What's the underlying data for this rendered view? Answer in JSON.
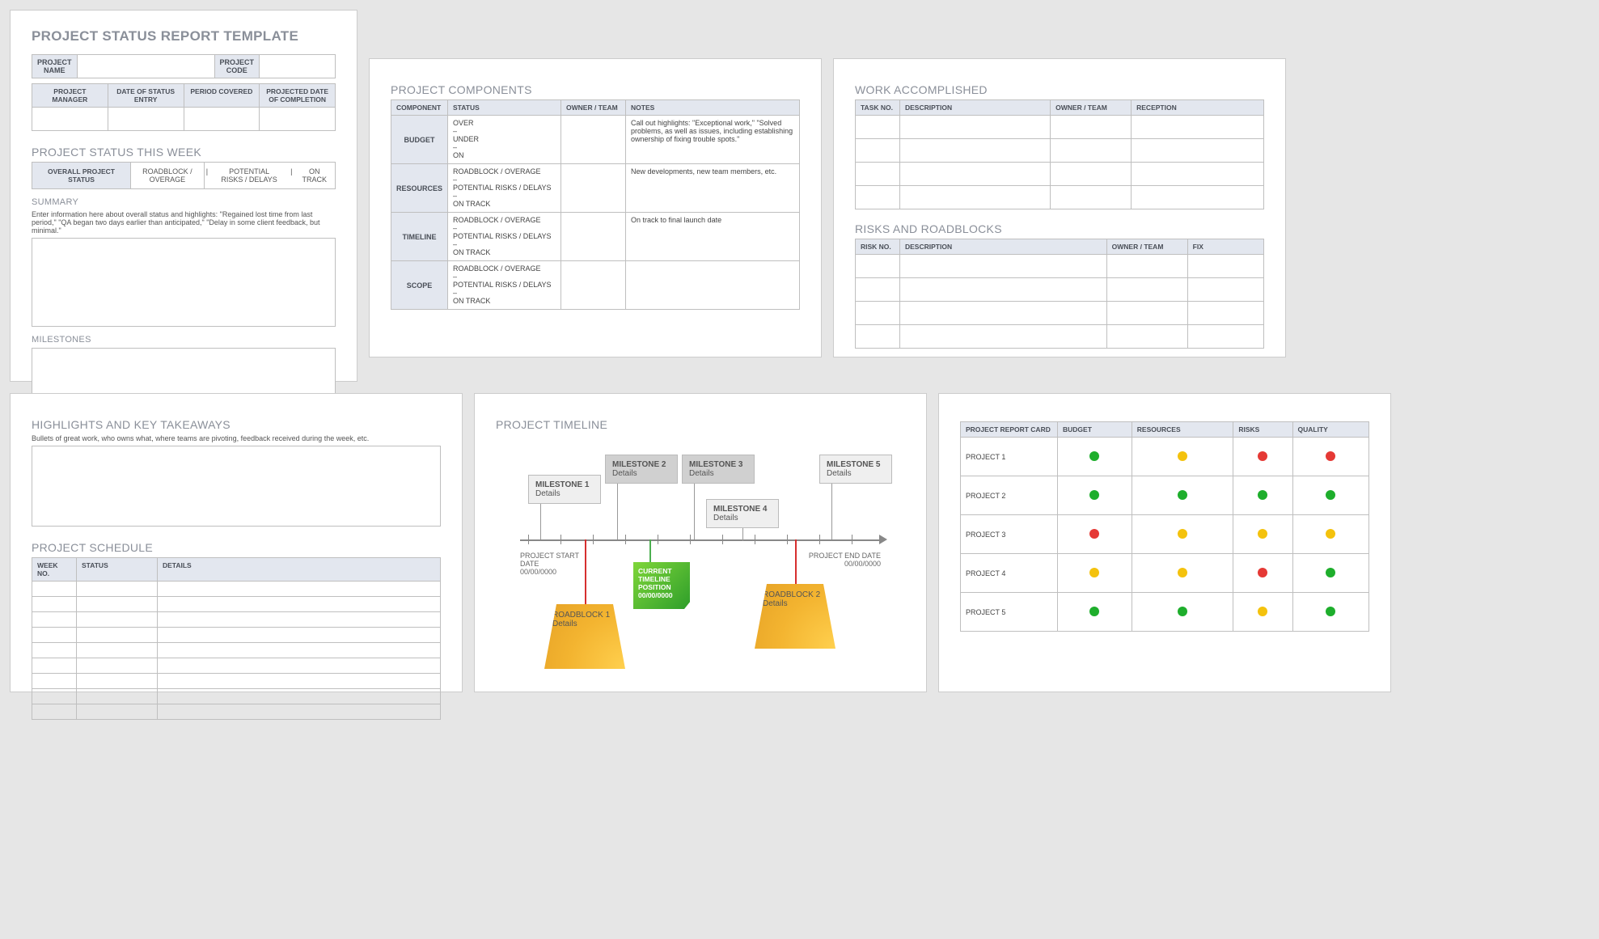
{
  "p1": {
    "title": "PROJECT STATUS REPORT TEMPLATE",
    "proj_name_lbl": "PROJECT NAME",
    "proj_code_lbl": "PROJECT CODE",
    "cols": [
      "PROJECT MANAGER",
      "DATE OF STATUS ENTRY",
      "PERIOD COVERED",
      "PROJECTED DATE OF COMPLETION"
    ],
    "week_title": "PROJECT STATUS THIS WEEK",
    "seg_lbl": "OVERALL PROJECT STATUS",
    "seg_opts": [
      "ROADBLOCK / OVERAGE",
      "|",
      "POTENTIAL RISKS / DELAYS",
      "|",
      "ON TRACK"
    ],
    "summary_lbl": "SUMMARY",
    "summary_hint": "Enter information here about overall status and highlights: \"Regained lost time from last period,\" \"QA began two days earlier than anticipated,\" \"Delay in some client feedback, but minimal.\"",
    "milestones_lbl": "MILESTONES"
  },
  "p2": {
    "title": "PROJECT COMPONENTS",
    "cols": [
      "COMPONENT",
      "STATUS",
      "OWNER / TEAM",
      "NOTES"
    ],
    "rows": [
      {
        "c": "BUDGET",
        "s": "OVER\n–\nUNDER\n–\nON",
        "n": "Call out highlights: \"Exceptional work,\" \"Solved problems, as well as issues, including establishing ownership of fixing trouble spots.\""
      },
      {
        "c": "RESOURCES",
        "s": "ROADBLOCK / OVERAGE\n–\nPOTENTIAL RISKS / DELAYS\n–\nON TRACK",
        "n": "New developments, new team members, etc."
      },
      {
        "c": "TIMELINE",
        "s": "ROADBLOCK / OVERAGE\n–\nPOTENTIAL RISKS / DELAYS\n–\nON TRACK",
        "n": "On track to final launch date"
      },
      {
        "c": "SCOPE",
        "s": "ROADBLOCK / OVERAGE\n–\nPOTENTIAL RISKS / DELAYS\n–\nON TRACK",
        "n": ""
      }
    ]
  },
  "p3": {
    "work_title": "WORK ACCOMPLISHED",
    "work_cols": [
      "TASK NO.",
      "DESCRIPTION",
      "OWNER / TEAM",
      "RECEPTION"
    ],
    "risk_title": "RISKS AND ROADBLOCKS",
    "risk_cols": [
      "RISK NO.",
      "DESCRIPTION",
      "OWNER / TEAM",
      "FIX"
    ]
  },
  "p4": {
    "hl_title": "HIGHLIGHTS AND KEY TAKEAWAYS",
    "hl_hint": "Bullets of great work, who owns what, where teams are pivoting, feedback received during the week, etc.",
    "sched_title": "PROJECT SCHEDULE",
    "sched_cols": [
      "WEEK NO.",
      "STATUS",
      "DETAILS"
    ]
  },
  "p5": {
    "title": "PROJECT TIMELINE",
    "start_lbl": "PROJECT START DATE",
    "start_date": "00/00/0000",
    "end_lbl": "PROJECT END DATE",
    "end_date": "00/00/0000",
    "ms": [
      "MILESTONE 1",
      "MILESTONE 2",
      "MILESTONE 3",
      "MILESTONE 4",
      "MILESTONE 5"
    ],
    "details": "Details",
    "rb": [
      "ROADBLOCK 1",
      "ROADBLOCK 2"
    ],
    "cur1": "CURRENT TIMELINE POSITION",
    "cur2": "00/00/0000"
  },
  "p6": {
    "title": "PROJECT REPORT CARD",
    "cols": [
      "BUDGET",
      "RESOURCES",
      "RISKS",
      "QUALITY"
    ],
    "rows": [
      {
        "n": "PROJECT 1",
        "v": [
          "g",
          "y",
          "r",
          "r"
        ]
      },
      {
        "n": "PROJECT 2",
        "v": [
          "g",
          "g",
          "g",
          "g"
        ]
      },
      {
        "n": "PROJECT 3",
        "v": [
          "r",
          "y",
          "y",
          "y"
        ]
      },
      {
        "n": "PROJECT 4",
        "v": [
          "y",
          "y",
          "r",
          "g"
        ]
      },
      {
        "n": "PROJECT 5",
        "v": [
          "g",
          "g",
          "y",
          "g"
        ]
      }
    ]
  }
}
